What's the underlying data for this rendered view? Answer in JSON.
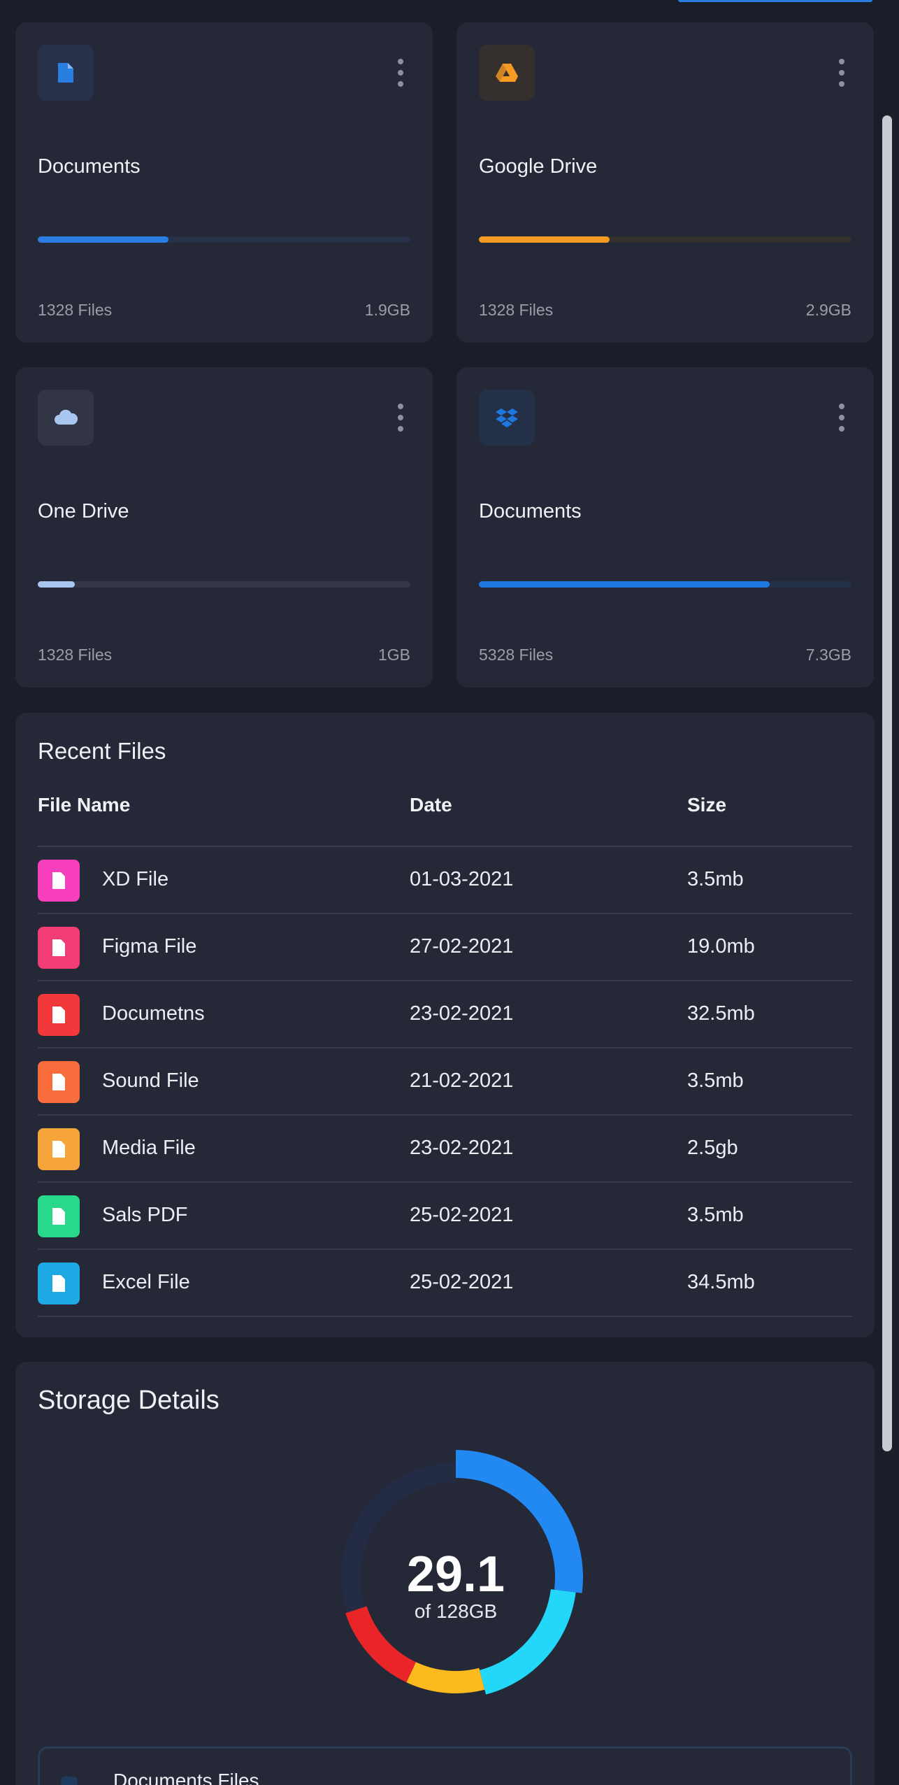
{
  "storage_cards": [
    {
      "title": "Documents",
      "files": "1328 Files",
      "size": "1.9GB",
      "progress": 0.35,
      "icon": "document-icon",
      "color": "#2a7de1",
      "track": "#273248",
      "icon_bg": "#27324a"
    },
    {
      "title": "Google Drive",
      "files": "1328 Files",
      "size": "2.9GB",
      "progress": 0.35,
      "icon": "google-drive-icon",
      "color": "#f59a23",
      "track": "#33302e",
      "icon_bg": "#352f2e"
    },
    {
      "title": "One Drive",
      "files": "1328 Files",
      "size": "1GB",
      "progress": 0.1,
      "icon": "cloud-icon",
      "color": "#a9c6f0",
      "track": "#343746",
      "icon_bg": "#323546"
    },
    {
      "title": "Documents",
      "files": "5328 Files",
      "size": "7.3GB",
      "progress": 0.78,
      "icon": "dropbox-icon",
      "color": "#1e78e0",
      "track": "#233048",
      "icon_bg": "#243048"
    }
  ],
  "recent_files": {
    "title": "Recent Files",
    "headers": {
      "name": "File Name",
      "date": "Date",
      "size": "Size"
    },
    "rows": [
      {
        "name": "XD File",
        "date": "01-03-2021",
        "size": "3.5mb",
        "icon": "xd-file-icon",
        "color": "#f73fbd"
      },
      {
        "name": "Figma File",
        "date": "27-02-2021",
        "size": "19.0mb",
        "icon": "figma-icon",
        "color": "#f23c74"
      },
      {
        "name": "Documetns",
        "date": "23-02-2021",
        "size": "32.5mb",
        "icon": "document-icon",
        "color": "#f2383b"
      },
      {
        "name": "Sound File",
        "date": "21-02-2021",
        "size": "3.5mb",
        "icon": "sound-icon",
        "color": "#f86d3b"
      },
      {
        "name": "Media File",
        "date": "23-02-2021",
        "size": "2.5gb",
        "icon": "media-icon",
        "color": "#f6a53a"
      },
      {
        "name": "Sals PDF",
        "date": "25-02-2021",
        "size": "3.5mb",
        "icon": "pdf-icon",
        "color": "#29d98b"
      },
      {
        "name": "Excel File",
        "date": "25-02-2021",
        "size": "34.5mb",
        "icon": "excel-icon",
        "color": "#1da9e3"
      }
    ]
  },
  "storage_details": {
    "title": "Storage Details",
    "used": "29.1",
    "total": "of 128GB",
    "segments": [
      {
        "value": 0.27,
        "color": "#2288f2"
      },
      {
        "value": 0.19,
        "color": "#22d7f8"
      },
      {
        "value": 0.11,
        "color": "#fbbb1e"
      },
      {
        "value": 0.13,
        "color": "#ea2528"
      },
      {
        "value": 0.3,
        "color": "#232c44"
      }
    ],
    "legend_first": "Documents Files"
  }
}
